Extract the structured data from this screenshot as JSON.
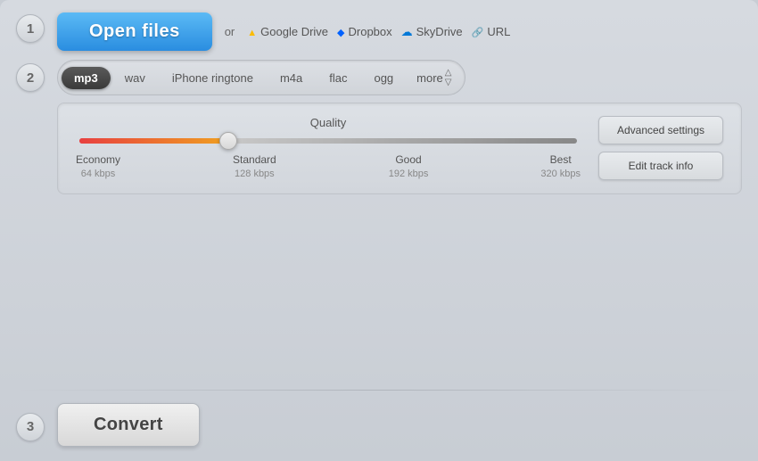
{
  "steps": {
    "step1": {
      "number": "1",
      "open_files_label": "Open files",
      "or_text": "or",
      "cloud_links": [
        {
          "id": "google-drive",
          "icon": "google-drive-icon",
          "label": "Google Drive"
        },
        {
          "id": "dropbox",
          "icon": "dropbox-icon",
          "label": "Dropbox"
        },
        {
          "id": "skydrive",
          "icon": "skydrive-icon",
          "label": "SkyDrive"
        },
        {
          "id": "url",
          "icon": "url-icon",
          "label": "URL"
        }
      ]
    },
    "step2": {
      "number": "2",
      "format_tabs": [
        {
          "id": "mp3",
          "label": "mp3",
          "active": true
        },
        {
          "id": "wav",
          "label": "wav",
          "active": false
        },
        {
          "id": "iphone-ringtone",
          "label": "iPhone ringtone",
          "active": false
        },
        {
          "id": "m4a",
          "label": "m4a",
          "active": false
        },
        {
          "id": "flac",
          "label": "flac",
          "active": false
        },
        {
          "id": "ogg",
          "label": "ogg",
          "active": false
        }
      ],
      "more_label": "more",
      "quality": {
        "title": "Quality",
        "slider_value": 30,
        "labels": [
          {
            "name": "Economy",
            "kbps": "64 kbps"
          },
          {
            "name": "Standard",
            "kbps": "128 kbps"
          },
          {
            "name": "Good",
            "kbps": "192 kbps"
          },
          {
            "name": "Best",
            "kbps": "320 kbps"
          }
        ]
      },
      "advanced_settings_label": "Advanced settings",
      "edit_track_info_label": "Edit track info"
    },
    "step3": {
      "number": "3",
      "convert_label": "Convert"
    }
  }
}
